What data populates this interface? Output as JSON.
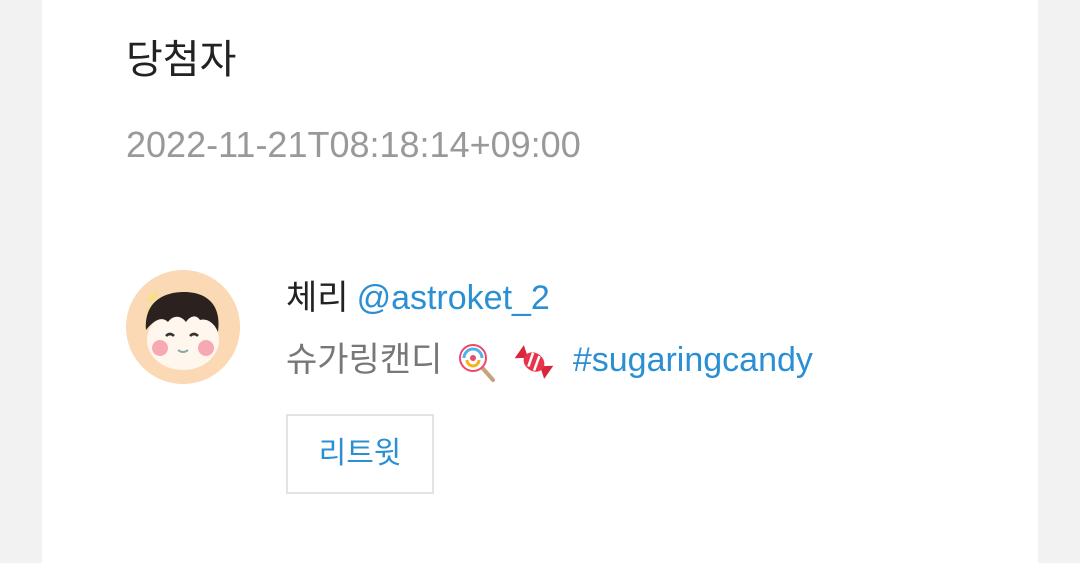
{
  "title": "당첨자",
  "timestamp": "2022-11-21T08:18:14+09:00",
  "winner": {
    "display_name": "체리",
    "handle": "@astroket_2",
    "bio_text": "슈가링캔디",
    "bio_emojis": [
      "lollipop-icon",
      "candy-icon"
    ],
    "hashtag": "#sugaringcandy"
  },
  "retweet_label": "리트윗",
  "colors": {
    "link": "#2a8fd3",
    "title": "#222222",
    "muted": "#999999",
    "avatar_bg": "#fbd9b5"
  }
}
